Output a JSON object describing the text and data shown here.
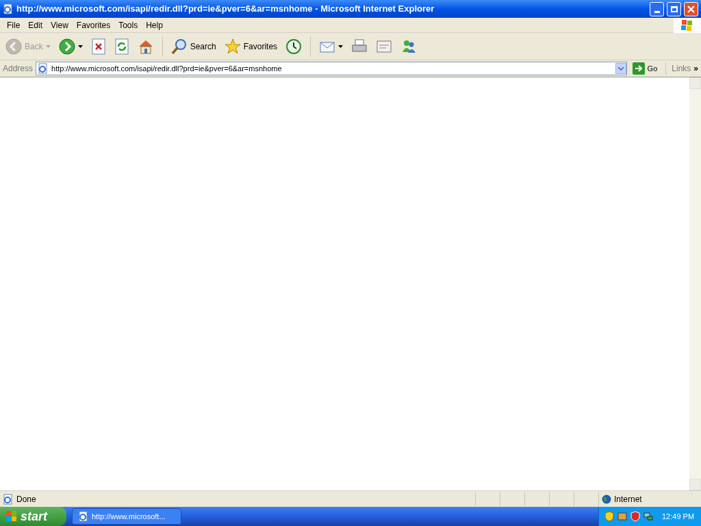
{
  "window": {
    "title": "http://www.microsoft.com/isapi/redir.dll?prd=ie&pver=6&ar=msnhome - Microsoft Internet Explorer"
  },
  "menu": [
    "File",
    "Edit",
    "View",
    "Favorites",
    "Tools",
    "Help"
  ],
  "toolbar": [
    {
      "kind": "back",
      "label": "Back",
      "disabled": true,
      "dropdown": true
    },
    {
      "kind": "forward",
      "disabled": false,
      "dropdown": true
    },
    {
      "kind": "stop",
      "disabled": false
    },
    {
      "kind": "refresh",
      "disabled": false
    },
    {
      "kind": "home",
      "disabled": false
    },
    {
      "kind": "search",
      "label": "Search",
      "disabled": false
    },
    {
      "kind": "favorites",
      "label": "Favorites",
      "disabled": false
    },
    {
      "kind": "history",
      "disabled": false
    },
    {
      "kind": "mail",
      "disabled": false,
      "dropdown": true
    },
    {
      "kind": "print",
      "disabled": false
    },
    {
      "kind": "edit",
      "disabled": false
    },
    {
      "kind": "messenger",
      "disabled": false
    }
  ],
  "address": {
    "label": "Address",
    "value": "http://www.microsoft.com/isapi/redir.dll?prd=ie&pver=6&ar=msnhome",
    "go": "Go",
    "links": "Links",
    "more": "»"
  },
  "status_bar": {
    "text": "Done",
    "zone": "Internet"
  },
  "taskbar": {
    "start": "start",
    "tasks": [
      {
        "label": "http://www.microsoft...",
        "selected": false
      }
    ],
    "clock": "12:49 PM"
  }
}
